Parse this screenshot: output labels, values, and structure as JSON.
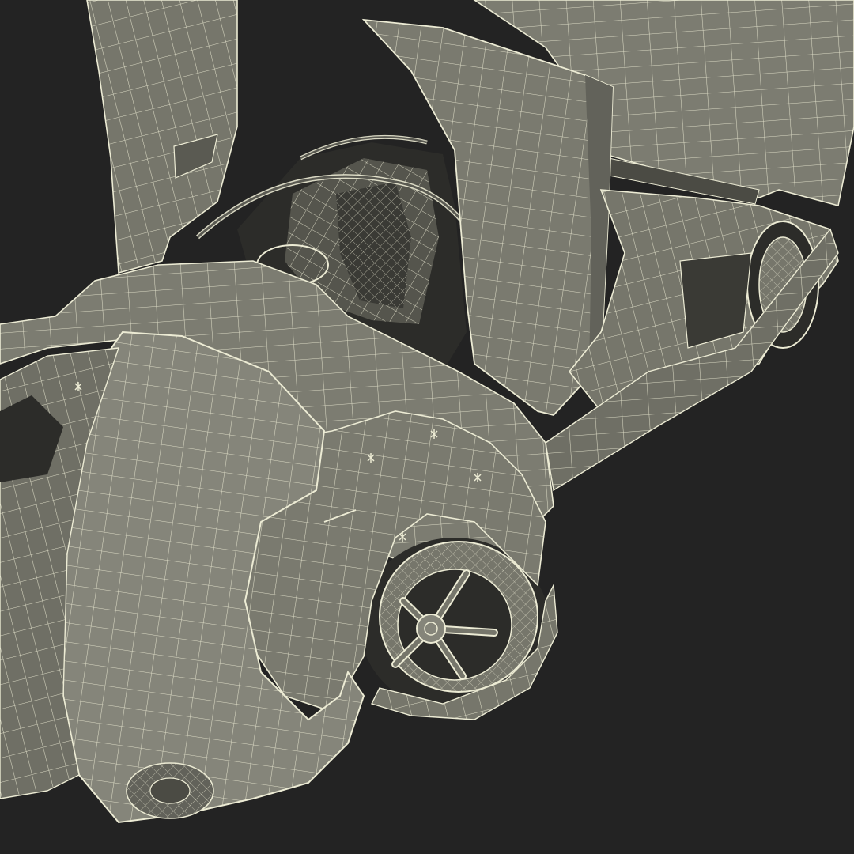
{
  "scene": {
    "subject": "car-wireframe-model",
    "colors": {
      "background": "#232323",
      "surface": "#76766b",
      "surface_light": "#85857a",
      "surface_dark": "#4b4b44",
      "interior": "#2c2c29",
      "wire": "#ecebd4"
    }
  }
}
